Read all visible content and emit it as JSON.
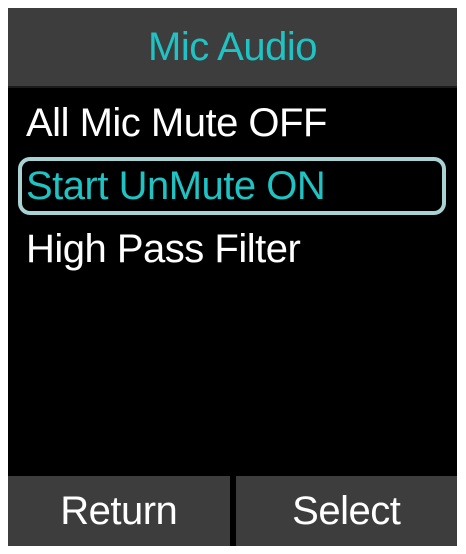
{
  "header": {
    "title": "Mic Audio"
  },
  "menu": {
    "items": [
      {
        "label": "All Mic Mute OFF",
        "selected": false
      },
      {
        "label": "Start UnMute ON",
        "selected": true
      },
      {
        "label": "High Pass Filter",
        "selected": false
      }
    ]
  },
  "softkeys": {
    "left_label": "Return",
    "right_label": "Select"
  },
  "colors": {
    "accent": "#1fc3c3",
    "bar_background": "#3d3d3d",
    "screen_background": "#000000",
    "selection_border": "#a9d3d3",
    "text": "#ffffff"
  }
}
